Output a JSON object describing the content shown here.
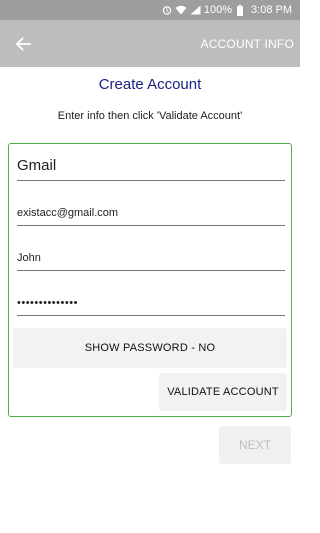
{
  "status_bar": {
    "battery_pct": "100%",
    "time": "3:08 PM",
    "icons": [
      "alarm-icon",
      "wifi-icon",
      "lte-signal-icon",
      "battery-icon"
    ]
  },
  "app_bar": {
    "back_icon": "arrow-left-icon",
    "title": "ACCOUNT INFO"
  },
  "page": {
    "title": "Create Account",
    "instructions": "Enter info then click 'Validate Account'"
  },
  "form": {
    "provider": "Gmail",
    "email": "existacc@gmail.com",
    "name": "John",
    "password_mask": "••••••••••••••",
    "show_password_label": "SHOW PASSWORD - NO",
    "validate_label": "VALIDATE ACCOUNT"
  },
  "footer": {
    "next_label": "NEXT"
  },
  "colors": {
    "status_bar": "#9e9e9e",
    "app_bar": "#bdbdbd",
    "title_text": "#1a237e",
    "card_border": "#4caf50",
    "button_bg": "#f2f2f2",
    "disabled_text": "#bdbdbd"
  }
}
